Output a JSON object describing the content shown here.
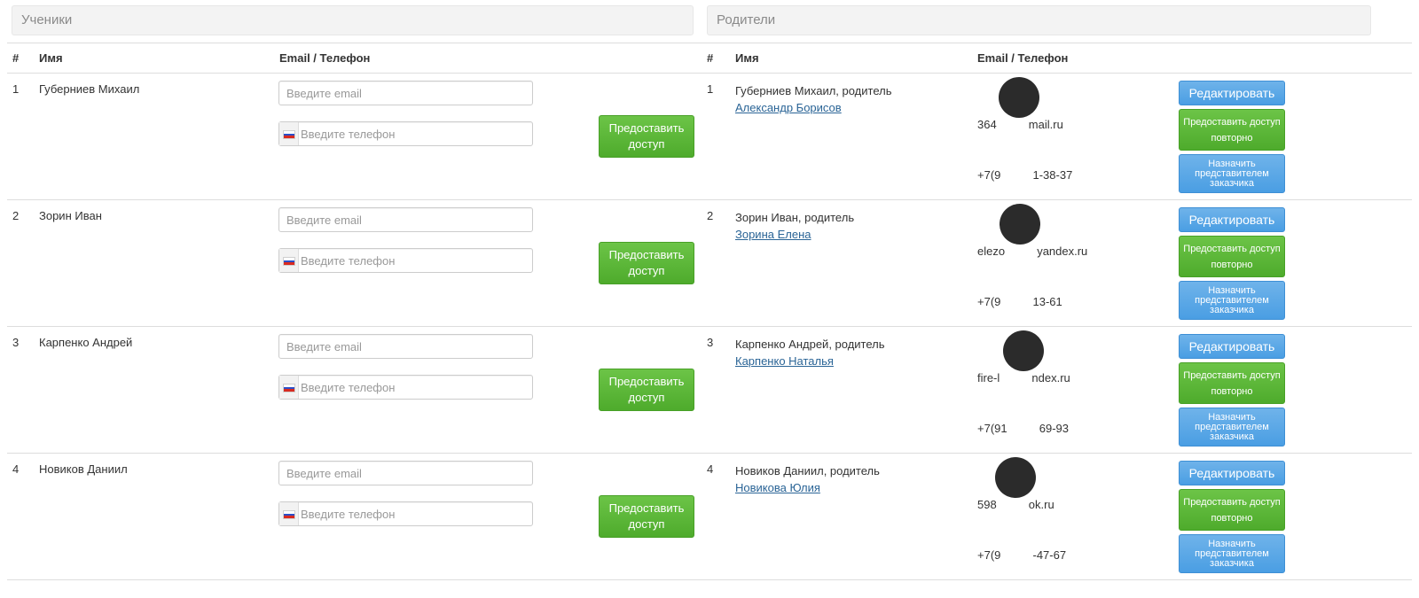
{
  "students_panel": {
    "title": "Ученики",
    "col_num": "#",
    "col_name": "Имя",
    "col_contact": "Email / Телефон"
  },
  "parents_panel": {
    "title": "Родители",
    "col_num": "#",
    "col_name": "Имя",
    "col_contact": "Email / Телефон"
  },
  "email_placeholder": "Введите email",
  "phone_placeholder": "Введите телефон",
  "grant_button_label": "Предоставить доступ",
  "edit_button_label": "Редактировать",
  "regrant_button_label": "Предоставить доступ повторно",
  "assign_button_label": "Назначить представителем заказчика",
  "colors": {
    "green": "#5cb83a",
    "blue": "#4a9ee3",
    "link": "#2a6496"
  },
  "rows": [
    {
      "num": "1",
      "student": "Губерниев Михаил",
      "parent_num": "1",
      "parent_of": "Губерниев Михаил, родитель",
      "parent_name": "Александр Борисов",
      "email": "364          mail.ru",
      "phone": "+7(9          1-38-37"
    },
    {
      "num": "2",
      "student": "Зорин Иван",
      "parent_num": "2",
      "parent_of": "Зорин Иван, родитель",
      "parent_name": "Зорина Елена",
      "email": "elezo          yandex.ru",
      "phone": "+7(9          13-61"
    },
    {
      "num": "3",
      "student": "Карпенко Андрей",
      "parent_num": "3",
      "parent_of": "Карпенко Андрей, родитель",
      "parent_name": "Карпенко Наталья",
      "email": "fire-l          ndex.ru",
      "phone": "+7(91          69-93"
    },
    {
      "num": "4",
      "student": "Новиков Даниил",
      "parent_num": "4",
      "parent_of": "Новиков Даниил, родитель",
      "parent_name": "Новикова Юлия",
      "email": "598          ok.ru",
      "phone": "+7(9          -47-67"
    }
  ]
}
